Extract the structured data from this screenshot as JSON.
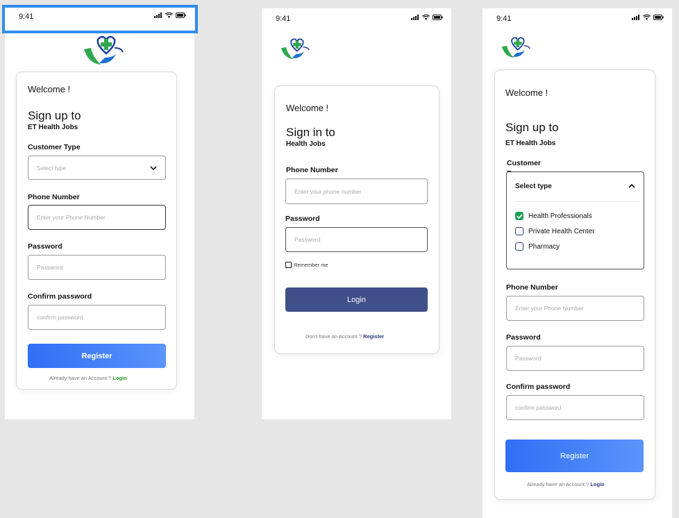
{
  "status_bar": {
    "time": "9:41"
  },
  "screens": {
    "signup": {
      "welcome": "Welcome !",
      "heading": "Sign up to",
      "subheading": "ET Health Jobs",
      "customer_type_label": "Customer Type",
      "customer_type_placeholder": "Select type",
      "phone_label": "Phone Number",
      "phone_placeholder": "Enter your Phone Number",
      "password_label": "Password",
      "password_placeholder": "Password",
      "confirm_label": "Confirm password",
      "confirm_placeholder": "confirm password",
      "register_button": "Register",
      "footer_text": "Already have an Account ?",
      "footer_link": "Login"
    },
    "signin": {
      "welcome": "Welcome !",
      "heading": "Sign in to",
      "subheading": "Health Jobs",
      "phone_label": "Phone Number",
      "phone_placeholder": "Enter your phone number",
      "password_label": "Password",
      "password_placeholder": "Password",
      "remember_label": "Remember me",
      "login_button": "Login",
      "footer_text": "Don't have an Account ?",
      "footer_link": "Register"
    },
    "signup_expanded": {
      "welcome": "Welcome !",
      "heading": "Sign up to",
      "subheading": "ET Health Jobs",
      "customer_type_label": "Customer Type",
      "select_title": "Select type",
      "options": [
        {
          "label": "Health Professionals",
          "checked": true
        },
        {
          "label": "Private Health Center",
          "checked": false
        },
        {
          "label": "Pharmacy",
          "checked": false
        }
      ],
      "phone_label": "Phone Number",
      "phone_placeholder": "Enter your Phone Number",
      "password_label": "Password",
      "password_placeholder": "Password",
      "confirm_label": "Confirm password",
      "confirm_placeholder": "confirm password",
      "register_button": "Register",
      "footer_text": "Already have an Account ?",
      "footer_link": "Login"
    }
  },
  "colors": {
    "accent_blue": "#2f6ff5",
    "navy": "#3f4f88",
    "link_green": "#1f9d1f",
    "link_navy": "#2b3a7a",
    "selection_outline": "#2f8ded",
    "check_green": "#1f9d57"
  },
  "icons": [
    "signal-icon",
    "wifi-icon",
    "battery-icon",
    "health-logo-icon",
    "chevron-down-icon",
    "chevron-up-icon",
    "checkbox-icon"
  ]
}
